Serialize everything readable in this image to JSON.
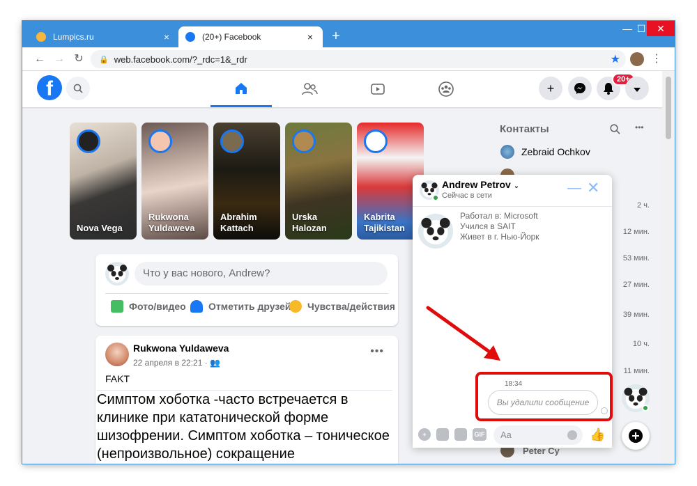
{
  "browser": {
    "tabs": [
      {
        "title": "Lumpics.ru",
        "close": "×"
      },
      {
        "title": "(20+) Facebook",
        "close": "×"
      }
    ],
    "new_tab": "+",
    "window_controls": {
      "minimize": "—",
      "maximize": "☐",
      "close": "✕"
    },
    "url": "web.facebook.com/?_rdc=1&_rdr",
    "icons": [
      "back-icon",
      "forward-icon",
      "reload-icon",
      "lock-icon",
      "star-icon",
      "menu-dots-icon"
    ]
  },
  "facebook": {
    "logo": "f",
    "notifications_badge": "20+",
    "stories": [
      {
        "name": "Nova Vega"
      },
      {
        "name": "Rukwona Yuldaweva"
      },
      {
        "name": "Abrahim Kattach"
      },
      {
        "name": "Urska Halozan"
      },
      {
        "name": "Kabrita Tajikistan"
      }
    ],
    "composer": {
      "placeholder": "Что у вас нового, Andrew?",
      "actions": [
        "Фото/видео",
        "Отметить друзей",
        "Чувства/действия"
      ]
    },
    "post": {
      "author": "Rukwona Yuldaweva",
      "date": "22 апреля в 22:21 ·",
      "tag": "FAKT",
      "body": "Симптом хоботка -часто встречается в клинике при кататонической форме шизофрении. Симптом хоботка – тоническое (непроизвольное) сокращение"
    },
    "contacts": {
      "title": "Контакты",
      "first": "Zebraid Ochkov",
      "last": "Peter Cy",
      "times": [
        "2 ч.",
        "12 мин.",
        "53 мин.",
        "27 мин.",
        "39 мин.",
        "10 ч.",
        "11 мин."
      ]
    },
    "chat": {
      "name": "Andrew Petrov",
      "status": "Сейчас в сети",
      "info": [
        "Работал в: Microsoft",
        "Учился в SAIT",
        "Живет в г. Нью-Йорк"
      ],
      "time": "18:34",
      "deleted_message": "Вы удалили сообщение",
      "input_placeholder": "Aa",
      "gif": "GIF"
    }
  },
  "colors": {
    "browser_blue": "#3c8fdb",
    "fb_blue": "#1877f2",
    "highlight_red": "#e00b0b",
    "badge_red": "#e41e3f",
    "online_green": "#31a24c"
  }
}
